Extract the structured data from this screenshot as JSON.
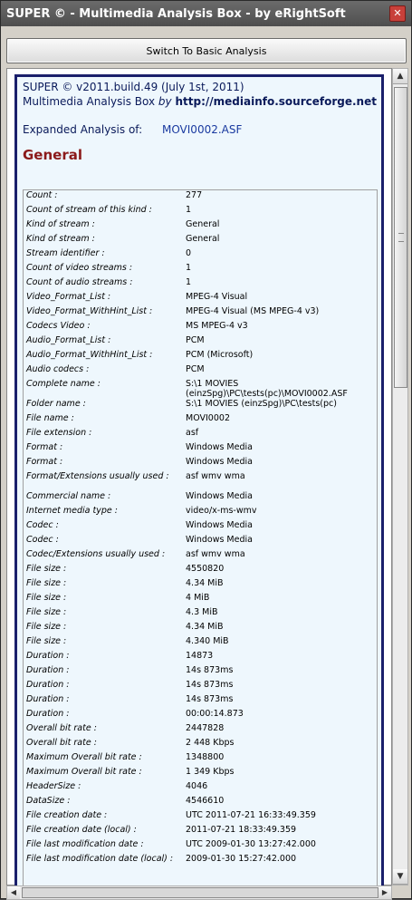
{
  "window": {
    "title": "SUPER ©  -  Multimedia Analysis Box  -  by eRightSoft",
    "close_glyph": "✕"
  },
  "toolbar": {
    "switch_label": "Switch To Basic Analysis"
  },
  "header": {
    "version": "SUPER © v2011.build.49 (July 1st, 2011)",
    "product": "Multimedia Analysis Box",
    "by": "by",
    "link": "http://mediainfo.sourceforge.net"
  },
  "expanded": {
    "label": "Expanded Analysis of:",
    "filename": "MOVI0002.ASF"
  },
  "section": {
    "title": "General"
  },
  "rows": [
    {
      "k": "Count :",
      "v": "277"
    },
    {
      "k": "Count of stream of this kind :",
      "v": "1"
    },
    {
      "k": "Kind of stream :",
      "v": "General"
    },
    {
      "k": "Kind of stream :",
      "v": "General"
    },
    {
      "k": "Stream identifier :",
      "v": "0"
    },
    {
      "k": "Count of video streams :",
      "v": "1"
    },
    {
      "k": "Count of audio streams :",
      "v": "1"
    },
    {
      "k": "Video_Format_List :",
      "v": "MPEG-4 Visual"
    },
    {
      "k": "Video_Format_WithHint_List :",
      "v": "MPEG-4 Visual (MS MPEG-4 v3)"
    },
    {
      "k": "Codecs Video :",
      "v": "MS MPEG-4 v3"
    },
    {
      "k": "Audio_Format_List :",
      "v": "PCM"
    },
    {
      "k": "Audio_Format_WithHint_List :",
      "v": "PCM (Microsoft)"
    },
    {
      "k": "Audio codecs :",
      "v": "PCM"
    },
    {
      "k": "Complete name :",
      "v": "S:\\1 MOVIES (einzSpg)\\PC\\tests(pc)\\MOVI0002.ASF",
      "tall": true
    },
    {
      "k": "Folder name :",
      "v": "S:\\1 MOVIES (einzSpg)\\PC\\tests(pc)"
    },
    {
      "k": "File name :",
      "v": "MOVI0002"
    },
    {
      "k": "File extension :",
      "v": "asf"
    },
    {
      "k": "Format :",
      "v": "Windows Media"
    },
    {
      "k": "Format :",
      "v": "Windows Media"
    },
    {
      "k": "Format/Extensions usually used :",
      "v": "asf wmv wma",
      "tall": true
    },
    {
      "k": "Commercial name :",
      "v": "Windows Media"
    },
    {
      "k": "Internet media type :",
      "v": "video/x-ms-wmv"
    },
    {
      "k": "Codec :",
      "v": "Windows Media"
    },
    {
      "k": "Codec :",
      "v": "Windows Media"
    },
    {
      "k": "Codec/Extensions usually used :",
      "v": "asf wmv wma"
    },
    {
      "k": "File size :",
      "v": "4550820"
    },
    {
      "k": "File size :",
      "v": "4.34 MiB"
    },
    {
      "k": "File size :",
      "v": "4 MiB"
    },
    {
      "k": "File size :",
      "v": "4.3 MiB"
    },
    {
      "k": "File size :",
      "v": "4.34 MiB"
    },
    {
      "k": "File size :",
      "v": "4.340 MiB"
    },
    {
      "k": "Duration :",
      "v": "14873"
    },
    {
      "k": "Duration :",
      "v": "14s 873ms"
    },
    {
      "k": "Duration :",
      "v": "14s 873ms"
    },
    {
      "k": "Duration :",
      "v": "14s 873ms"
    },
    {
      "k": "Duration :",
      "v": "00:00:14.873"
    },
    {
      "k": "Overall bit rate :",
      "v": "2447828"
    },
    {
      "k": "Overall bit rate :",
      "v": "2 448 Kbps"
    },
    {
      "k": "Maximum Overall bit rate :",
      "v": "1348800"
    },
    {
      "k": "Maximum Overall bit rate :",
      "v": "1 349 Kbps"
    },
    {
      "k": "HeaderSize :",
      "v": "4046"
    },
    {
      "k": "DataSize :",
      "v": "4546610"
    },
    {
      "k": "File creation date :",
      "v": "UTC 2011-07-21 16:33:49.359"
    },
    {
      "k": "File creation date (local) :",
      "v": "2011-07-21 18:33:49.359"
    },
    {
      "k": "File last modification date :",
      "v": "UTC 2009-01-30 13:27:42.000"
    },
    {
      "k": "File last modification date (local) :",
      "v": "2009-01-30 15:27:42.000",
      "tall": true
    }
  ],
  "scrollbar": {
    "up_glyph": "▲",
    "down_glyph": "▼",
    "left_glyph": "◀",
    "right_glyph": "▶"
  }
}
